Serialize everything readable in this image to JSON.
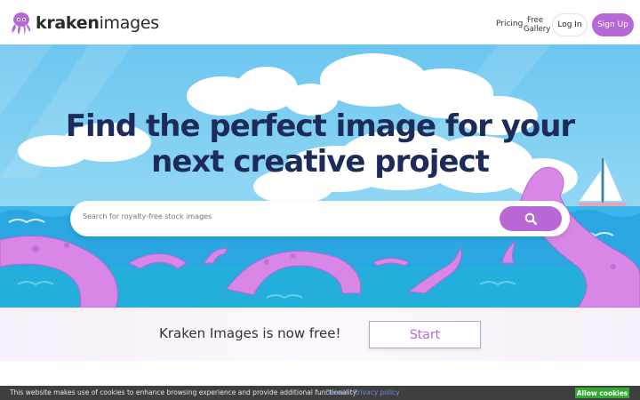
{
  "header": {
    "logo_text_bold": "kraken",
    "logo_text_light": "images",
    "nav_pricing": "Pricing",
    "nav_free_gallery_line1": "Free",
    "nav_free_gallery_line2": "Gallery",
    "login_label": "Log In",
    "signup_label": "Sign Up"
  },
  "hero": {
    "title_line1": "Find the perfect image for your",
    "title_line2": "next creative project",
    "search_placeholder": "Search for royalty-free stock images",
    "search_icon": "magnifier-icon"
  },
  "promo": {
    "text": "Kraken Images is now free!",
    "button_label": "Start"
  },
  "cookie": {
    "text": "This website makes use of cookies to enhance browsing experience and provide additional functionality.",
    "details_label": "Details",
    "privacy_label": "Privacy policy",
    "allow_label": "Allow cookies"
  },
  "colors": {
    "brand_purple": "#b867d6",
    "title_navy": "#1d2b5a",
    "sky_blue": "#7fd0f2",
    "sea_blue": "#2aa6e0",
    "tentacle_pink": "#d987e6",
    "cookie_green": "#33aa33"
  }
}
